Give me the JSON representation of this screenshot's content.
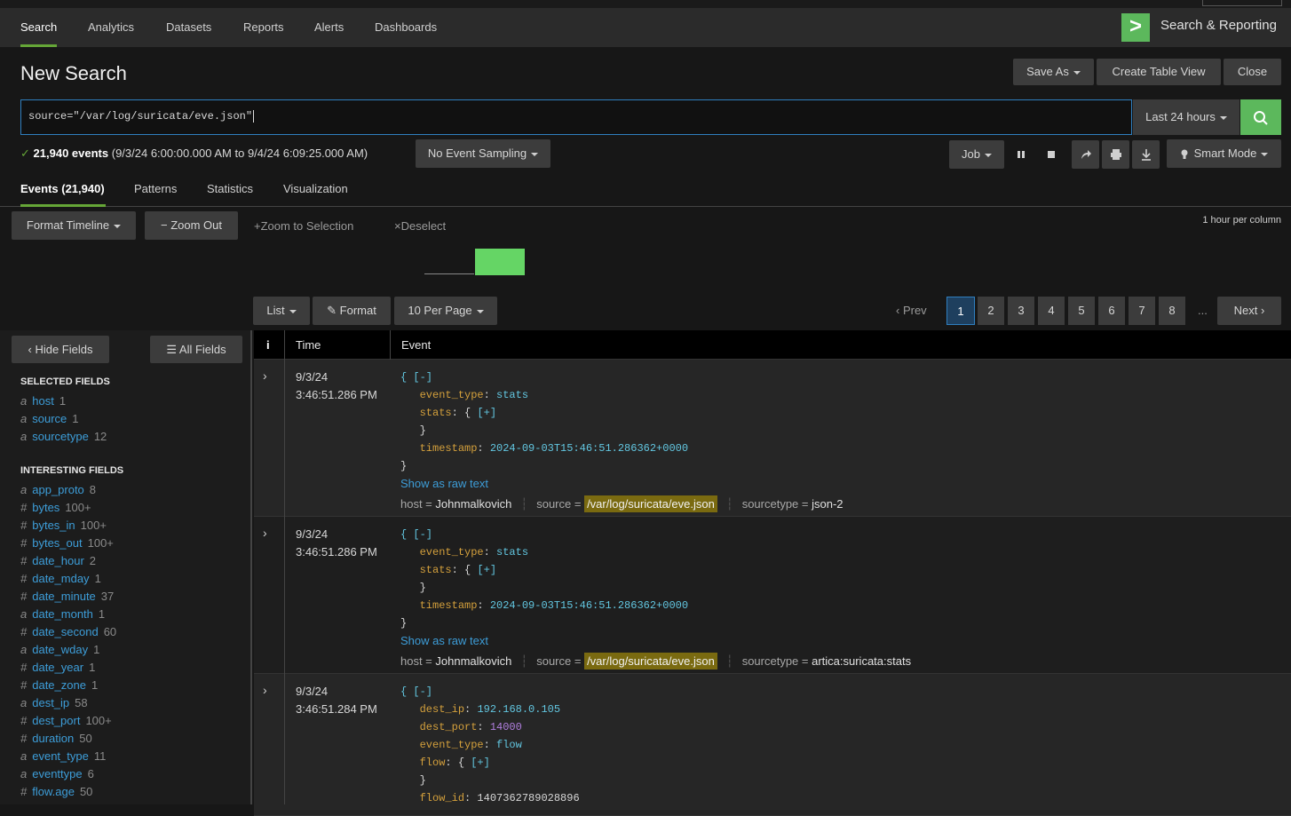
{
  "nav": {
    "items": [
      "Search",
      "Analytics",
      "Datasets",
      "Reports",
      "Alerts",
      "Dashboards"
    ],
    "app_logo": ">",
    "app_name": "Search & Reporting"
  },
  "page": {
    "title": "New Search",
    "save_as": "Save As",
    "create_table_view": "Create Table View",
    "close": "Close"
  },
  "search": {
    "query": "source=\"/var/log/suricata/eve.json\"",
    "time_range": "Last 24 hours",
    "go_icon": "search-icon"
  },
  "status": {
    "check": "✓",
    "count": "21,940 events",
    "range": "(9/3/24 6:00:00.000 AM to 9/4/24 6:09:25.000 AM)",
    "sampling": "No Event Sampling",
    "job": "Job",
    "mode": "Smart Mode"
  },
  "tabs": [
    "Events (21,940)",
    "Patterns",
    "Statistics",
    "Visualization"
  ],
  "timeline": {
    "format": "Format Timeline",
    "zoom_out": "Zoom Out",
    "zoom_sel": "Zoom to Selection",
    "deselect": "Deselect",
    "hint": "1 hour per column"
  },
  "results": {
    "list": "List",
    "format": "Format",
    "per_page": "10 Per Page",
    "prev": "Prev",
    "pages": [
      "1",
      "2",
      "3",
      "4",
      "5",
      "6",
      "7",
      "8"
    ],
    "ellipsis": "...",
    "next": "Next"
  },
  "fields": {
    "hide": "Hide Fields",
    "all": "All Fields",
    "selected_title": "SELECTED FIELDS",
    "selected": [
      {
        "type": "a",
        "name": "host",
        "count": "1"
      },
      {
        "type": "a",
        "name": "source",
        "count": "1"
      },
      {
        "type": "a",
        "name": "sourcetype",
        "count": "12"
      }
    ],
    "interesting_title": "INTERESTING FIELDS",
    "interesting": [
      {
        "type": "a",
        "name": "app_proto",
        "count": "8"
      },
      {
        "type": "#",
        "name": "bytes",
        "count": "100+"
      },
      {
        "type": "#",
        "name": "bytes_in",
        "count": "100+"
      },
      {
        "type": "#",
        "name": "bytes_out",
        "count": "100+"
      },
      {
        "type": "#",
        "name": "date_hour",
        "count": "2"
      },
      {
        "type": "#",
        "name": "date_mday",
        "count": "1"
      },
      {
        "type": "#",
        "name": "date_minute",
        "count": "37"
      },
      {
        "type": "a",
        "name": "date_month",
        "count": "1"
      },
      {
        "type": "#",
        "name": "date_second",
        "count": "60"
      },
      {
        "type": "a",
        "name": "date_wday",
        "count": "1"
      },
      {
        "type": "#",
        "name": "date_year",
        "count": "1"
      },
      {
        "type": "#",
        "name": "date_zone",
        "count": "1"
      },
      {
        "type": "a",
        "name": "dest_ip",
        "count": "58"
      },
      {
        "type": "#",
        "name": "dest_port",
        "count": "100+"
      },
      {
        "type": "#",
        "name": "duration",
        "count": "50"
      },
      {
        "type": "a",
        "name": "event_type",
        "count": "11"
      },
      {
        "type": "a",
        "name": "eventtype",
        "count": "6"
      },
      {
        "type": "#",
        "name": "flow.age",
        "count": "50"
      }
    ]
  },
  "table": {
    "info_col": "i",
    "time_col": "Time",
    "event_col": "Event"
  },
  "events": [
    {
      "date": "9/3/24",
      "time": "3:46:51.286 PM",
      "lines": [
        [
          [
            "br",
            "{ [-]"
          ]
        ],
        [
          [
            "",
            "   "
          ],
          [
            "k",
            "event_type"
          ],
          [
            "",
            ": "
          ],
          [
            "s",
            "stats"
          ]
        ],
        [
          [
            "",
            "   "
          ],
          [
            "k",
            "stats"
          ],
          [
            "",
            ": { "
          ],
          [
            "br",
            "[+]"
          ]
        ],
        [
          [
            "",
            "   }"
          ]
        ],
        [
          [
            "",
            "   "
          ],
          [
            "k",
            "timestamp"
          ],
          [
            "",
            ": "
          ],
          [
            "s",
            "2024-09-03T15:46:51.286362+0000"
          ]
        ],
        [
          [
            "",
            "}"
          ]
        ]
      ],
      "raw": "Show as raw text",
      "host": "Johnmalkovich",
      "source": "/var/log/suricata/eve.json",
      "sourcetype": "json-2"
    },
    {
      "date": "9/3/24",
      "time": "3:46:51.286 PM",
      "lines": [
        [
          [
            "br",
            "{ [-]"
          ]
        ],
        [
          [
            "",
            "   "
          ],
          [
            "k",
            "event_type"
          ],
          [
            "",
            ": "
          ],
          [
            "s",
            "stats"
          ]
        ],
        [
          [
            "",
            "   "
          ],
          [
            "k",
            "stats"
          ],
          [
            "",
            ": { "
          ],
          [
            "br",
            "[+]"
          ]
        ],
        [
          [
            "",
            "   }"
          ]
        ],
        [
          [
            "",
            "   "
          ],
          [
            "k",
            "timestamp"
          ],
          [
            "",
            ": "
          ],
          [
            "s",
            "2024-09-03T15:46:51.286362+0000"
          ]
        ],
        [
          [
            "",
            "}"
          ]
        ]
      ],
      "raw": "Show as raw text",
      "host": "Johnmalkovich",
      "source": "/var/log/suricata/eve.json",
      "sourcetype": "artica:suricata:stats"
    },
    {
      "date": "9/3/24",
      "time": "3:46:51.284 PM",
      "lines": [
        [
          [
            "br",
            "{ [-]"
          ]
        ],
        [
          [
            "",
            "   "
          ],
          [
            "k",
            "dest_ip"
          ],
          [
            "",
            ": "
          ],
          [
            "s",
            "192.168.0.105"
          ]
        ],
        [
          [
            "",
            "   "
          ],
          [
            "k",
            "dest_port"
          ],
          [
            "",
            ": "
          ],
          [
            "n",
            "14000"
          ]
        ],
        [
          [
            "",
            "   "
          ],
          [
            "k",
            "event_type"
          ],
          [
            "",
            ": "
          ],
          [
            "s",
            "flow"
          ]
        ],
        [
          [
            "",
            "   "
          ],
          [
            "k",
            "flow"
          ],
          [
            "",
            ": { "
          ],
          [
            "br",
            "[+]"
          ]
        ],
        [
          [
            "",
            "   }"
          ]
        ],
        [
          [
            "",
            "   "
          ],
          [
            "k",
            "flow_id"
          ],
          [
            "",
            ": 1407362789028896"
          ]
        ]
      ]
    }
  ],
  "meta_labels": {
    "host": "host =",
    "source": "source =",
    "sourcetype": "sourcetype ="
  },
  "colors": {
    "accent_green": "#5cb85c",
    "link_blue": "#3d9dd8",
    "json_key": "#d4a03c",
    "json_string": "#62c6e0",
    "highlight": "#7a6a10"
  }
}
